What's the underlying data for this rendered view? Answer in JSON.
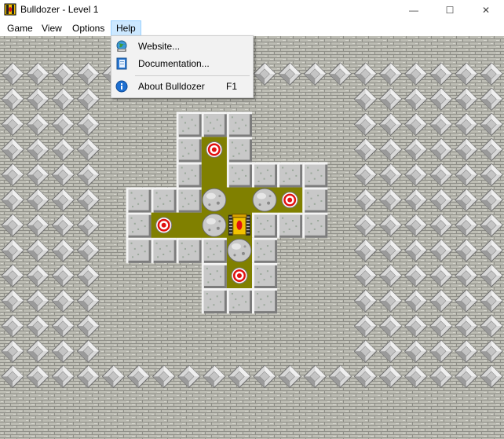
{
  "window": {
    "title": "Bulldozer - Level 1",
    "minimize_glyph": "—",
    "maximize_glyph": "☐",
    "close_glyph": "✕"
  },
  "menubar": {
    "items": [
      "Game",
      "View",
      "Options",
      "Help"
    ],
    "open_menu": "Help"
  },
  "help_menu": {
    "items": [
      {
        "label": "Website...",
        "accelerator": "",
        "icon": "globe-icon"
      },
      {
        "label": "Documentation...",
        "accelerator": "",
        "icon": "book-icon"
      },
      {
        "label": "About Bulldozer",
        "accelerator": "F1",
        "icon": "info-icon"
      }
    ]
  },
  "board": {
    "grid": {
      "cols": 20,
      "rows": 16
    },
    "tiles_legend": {
      "D": "diamond-background-tile",
      "F": "floor-tile",
      "W": "wall-block",
      "T": "target-floor",
      "R": "rock-on-floor",
      "B": "bulldozer"
    },
    "rows": [
      "....................",
      "DDDDDDDDDDDDDDDDDDDD",
      "DDDD..........DDDDDD",
      "DDDD...WWW....DDDDDD",
      "DDDD...WTW....DDDDDD",
      "DDDD...WFWWWW.DDDDDD",
      "DDDD.WWWRFRTW.DDDDDD",
      "DDDD.WTFRBWWW.DDDDDD",
      "DDDD.WWWWRW...DDDDDD",
      "DDDD....WTW...DDDDDD",
      "DDDD....WWW...DDDDDD",
      "DDDD..........DDDDDD",
      "DDDD..........DDDDDD",
      "DDDDDDDDDDDDDDDDDDDD",
      "....................",
      "...................."
    ],
    "colors": {
      "floor": "#808000",
      "wall": "#c8c8c8",
      "brick": "#bdbdb4",
      "mortar": "#8a8a84",
      "target": "#e01010"
    }
  }
}
